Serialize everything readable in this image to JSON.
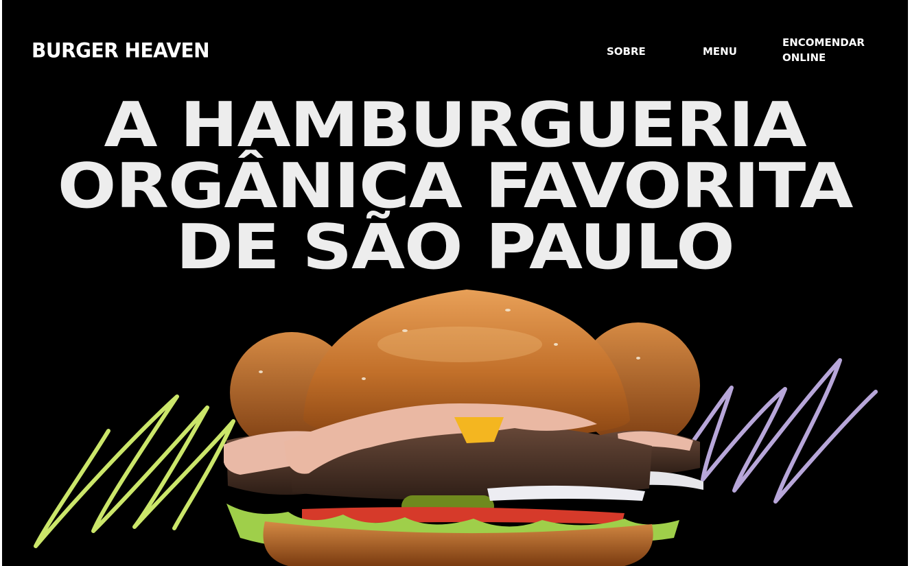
{
  "header": {
    "logo": "BURGER HEAVEN",
    "nav": [
      {
        "label": "SOBRE"
      },
      {
        "label": "MENU"
      },
      {
        "label_line1": "ENCOMENDAR",
        "label_line2": "ONLINE"
      }
    ]
  },
  "hero": {
    "headline_lines": [
      "A HAMBURGUERIA",
      "ORGÂNICA FAVORITA",
      "DE SÃO PAULO"
    ]
  },
  "colors": {
    "background": "#000000",
    "headline": "#ededed",
    "scribble_left": "#cbe66a",
    "scribble_right": "#b7a6d9",
    "bun": "#c2702a"
  },
  "icons": [
    "burger-image",
    "green-scribble",
    "purple-scribble"
  ]
}
